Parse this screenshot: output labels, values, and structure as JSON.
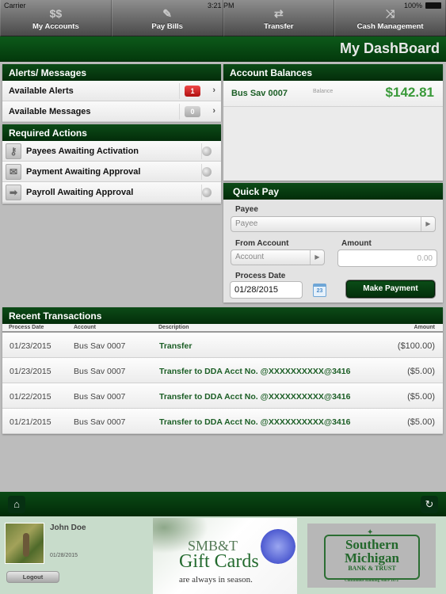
{
  "status_bar": {
    "carrier": "Carrier",
    "time": "3:21 PM",
    "battery": "100%"
  },
  "nav": [
    {
      "label": "My Accounts",
      "icon": "dollar-icon"
    },
    {
      "label": "Pay Bills",
      "icon": "bill-icon"
    },
    {
      "label": "Transfer",
      "icon": "transfer-arrows-icon"
    },
    {
      "label": "Cash Management",
      "icon": "shuffle-icon"
    }
  ],
  "page_title": "My DashBoard",
  "alerts": {
    "title": "Alerts/ Messages",
    "items": [
      {
        "label": "Available Alerts",
        "count": "1"
      },
      {
        "label": "Available Messages",
        "count": "0"
      }
    ]
  },
  "required_actions": {
    "title": "Required Actions",
    "items": [
      {
        "label": "Payees Awaiting Activation",
        "icon": "key-icon"
      },
      {
        "label": "Payment Awaiting Approval",
        "icon": "envelope-icon"
      },
      {
        "label": "Payroll Awaiting Approval",
        "icon": "arrow-right-icon"
      }
    ]
  },
  "balances": {
    "title": "Account Balances",
    "account": "Bus Sav 0007",
    "balance_label": "Balance",
    "balance": "$142.81"
  },
  "quick_pay": {
    "title": "Quick Pay",
    "payee_label": "Payee",
    "payee_placeholder": "Payee",
    "from_label": "From Account",
    "from_placeholder": "Account",
    "amount_label": "Amount",
    "amount_placeholder": "0.00",
    "date_label": "Process Date",
    "date_value": "01/28/2015",
    "calendar_day": "23",
    "button": "Make Payment"
  },
  "transactions": {
    "title": "Recent Transactions",
    "columns": [
      "Process Date",
      "Account",
      "Description",
      "Amount"
    ],
    "rows": [
      {
        "date": "01/23/2015",
        "account": "Bus Sav 0007",
        "description": "Transfer",
        "amount": "($100.00)"
      },
      {
        "date": "01/23/2015",
        "account": "Bus Sav 0007",
        "description": "Transfer to DDA Acct No. @XXXXXXXXXX@3416",
        "amount": "($5.00)"
      },
      {
        "date": "01/22/2015",
        "account": "Bus Sav 0007",
        "description": "Transfer to DDA Acct No. @XXXXXXXXXX@3416",
        "amount": "($5.00)"
      },
      {
        "date": "01/21/2015",
        "account": "Bus Sav 0007",
        "description": "Transfer to DDA Acct No. @XXXXXXXXXX@3416",
        "amount": "($5.00)"
      }
    ]
  },
  "user": {
    "name": "John Doe",
    "date": "01/28/2015",
    "logout": "Logout"
  },
  "ad": {
    "line1": "SMB&T",
    "line2": "Gift Cards",
    "line3": "are always in season."
  },
  "logo": {
    "line1": "Southern",
    "line2": "Michigan",
    "line3": "BANK & TRUST",
    "tagline": "Continuous Banking Since 1872"
  }
}
